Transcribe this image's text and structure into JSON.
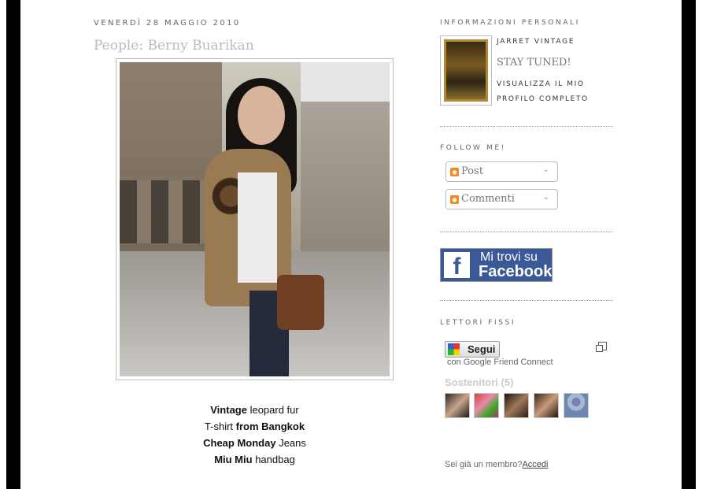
{
  "post": {
    "date": "venerdì 28 maggio 2010",
    "title": "People: Berny Buarikan",
    "caption": [
      {
        "bold": "Vintage",
        "rest": " leopard fur"
      },
      {
        "pre": "T-shirt ",
        "bold": "from Bangkok"
      },
      {
        "bold": "Cheap Monday",
        "rest": " Jeans"
      },
      {
        "bold": "Miu Miu",
        "rest": " handbag"
      }
    ]
  },
  "sidebar": {
    "profile": {
      "heading": "Informazioni personali",
      "name": "Jarret Vintage",
      "about": "STAY TUNED!",
      "link": "Visualizza il mio profilo completo"
    },
    "follow": {
      "heading": "Follow me!",
      "post_label": "Post",
      "comments_label": "Commenti"
    },
    "facebook": {
      "line1": "Mi trovi su",
      "line2": "Facebook"
    },
    "followers": {
      "heading": "Lettori fissi",
      "button_label": "Segui",
      "gfc_text": "con Google Friend Connect",
      "title": "Sostenitori (5)",
      "member_text": "Sei già un membro?",
      "member_link": "Accedi"
    }
  },
  "colors": {
    "border": "#000000",
    "facebook_blue": "#3b5998",
    "rss_orange": "#f0871f"
  }
}
